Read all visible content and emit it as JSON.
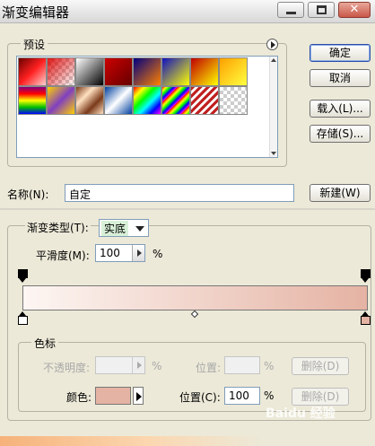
{
  "window": {
    "title": "渐变编辑器"
  },
  "presets": {
    "label": "预设",
    "swatches": [
      "preset-1",
      "preset-2",
      "preset-3",
      "preset-4",
      "preset-5",
      "preset-6",
      "preset-7",
      "preset-8",
      "preset-9",
      "preset-10",
      "preset-11",
      "preset-12",
      "preset-13",
      "preset-14",
      "preset-15",
      "preset-16"
    ]
  },
  "buttons": {
    "ok": "确定",
    "cancel": "取消",
    "load": "载入(L)...",
    "save": "存储(S)...",
    "new": "新建(W)"
  },
  "name_field": {
    "label": "名称(N):",
    "value": "自定"
  },
  "gradient": {
    "type_label": "渐变类型(T):",
    "type_value": "实底",
    "smoothness_label": "平滑度(M):",
    "smoothness_value": "100",
    "smoothness_unit": "%",
    "start_color": "#fdf6f3",
    "end_color": "#e5b3a3"
  },
  "stops": {
    "group_label": "色标",
    "opacity_label": "不透明度:",
    "opacity_unit": "%",
    "opacity_location_label": "位置:",
    "opacity_location_unit": "%",
    "opacity_delete": "删除(D)",
    "color_label": "颜色:",
    "color_value": "#e5b3a3",
    "location_label": "位置(C):",
    "location_value": "100",
    "location_unit": "%",
    "color_delete": "删除(D)"
  },
  "watermark": "Baidu 经验"
}
